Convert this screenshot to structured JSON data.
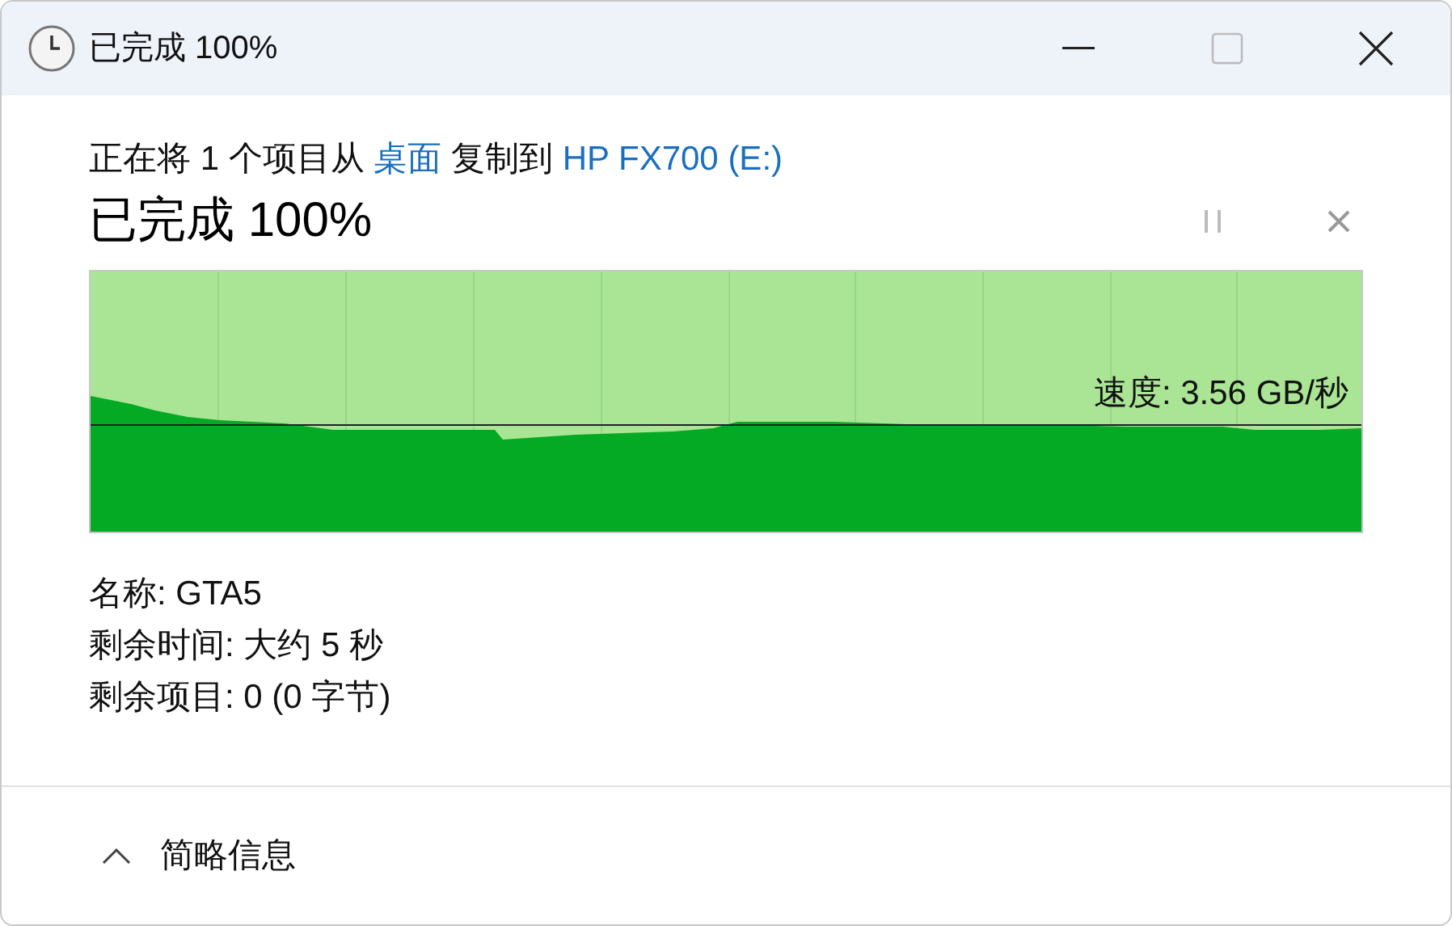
{
  "window": {
    "title": "已完成 100%"
  },
  "description": [
    {
      "text": "正在将 1 个项目从 ",
      "link": false
    },
    {
      "text": "桌面",
      "link": true
    },
    {
      "text": " 复制到 ",
      "link": false
    },
    {
      "text": "HP FX700 (E:)",
      "link": true
    }
  ],
  "status": "已完成 100%",
  "progress": {
    "level": 1,
    "speed": "速度: 3.56 GB/秒"
  },
  "details": [
    "名称: GTA5",
    "剩余时间: 大约 5 秒",
    "剩余项目: 0 (0 字节)"
  ],
  "footer": {
    "label": "简略信息",
    "expanded": true
  }
}
